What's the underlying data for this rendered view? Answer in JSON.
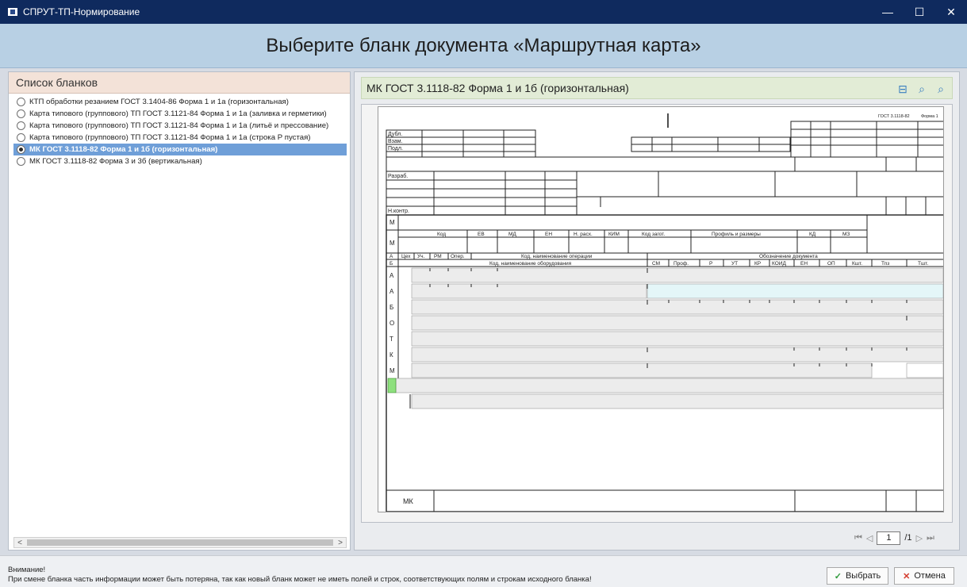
{
  "window": {
    "title": "СПРУТ-ТП-Нормирование",
    "minimize_icon": "—",
    "maximize_icon": "☐",
    "close_icon": "✕"
  },
  "header": {
    "title": "Выберите бланк документа «Маршрутная карта»"
  },
  "blank_list": {
    "heading": "Список бланков",
    "items": [
      {
        "label": "КТП обработки резанием ГОСТ 3.1404-86 Форма 1 и 1а (горизонтальная)",
        "selected": false
      },
      {
        "label": "Карта типового (группового) ТП ГОСТ 3.1121-84 Форма 1 и 1а (заливка и герметики)",
        "selected": false
      },
      {
        "label": "Карта типового (группового) ТП ГОСТ 3.1121-84 Форма 1 и 1а (литьё и прессование)",
        "selected": false
      },
      {
        "label": "Карта типового (группового) ТП ГОСТ 3.1121-84 Форма 1 и 1а (строка Р пустая)",
        "selected": false
      },
      {
        "label": "МК ГОСТ 3.1118-82 Форма 1 и 1б (горизонтальная)",
        "selected": true
      },
      {
        "label": "МК ГОСТ 3.1118-82 Форма 3 и 3б (вертикальная)",
        "selected": false
      }
    ],
    "scroll_left": "<",
    "scroll_right": ">"
  },
  "preview": {
    "title": "МК ГОСТ 3.1118-82 Форма 1 и 1б (горизонтальная)",
    "tools": {
      "fit_icon": "⊟",
      "zoom_out_icon": "⌕",
      "zoom_in_icon": "⌕"
    },
    "form": {
      "gost": "ГОСТ 3.1118-82",
      "forma": "Форма 1",
      "dubl": "Дубл.",
      "vzam": "Взам.",
      "podl": "Подл.",
      "razrab": "Разраб.",
      "nkontr": "Н.контр.",
      "m_headers": [
        "Код",
        "ЕВ",
        "МД",
        "ЕН",
        "Н. расх.",
        "КИМ",
        "Код загот.",
        "Профиль и размеры",
        "КД",
        "МЗ"
      ],
      "a_headers": [
        "А",
        "Цех",
        "Уч.",
        "РМ",
        "Опер.",
        "Код, наименование операции",
        "Обозначение документа"
      ],
      "b_headers": [
        "Б",
        "Код, наименование оборудования",
        "СМ",
        "Проф.",
        "Р",
        "УТ",
        "КР",
        "КОИД",
        "ЕН",
        "ОП",
        "Кшт.",
        "Тпз",
        "Тшт."
      ],
      "row_letters": [
        "А",
        "А",
        "Б",
        "О",
        "Т",
        "К",
        "М"
      ],
      "m_label": "М",
      "footer_code": "МК"
    },
    "pager": {
      "first_icon": "⏮",
      "prev_icon": "◁",
      "page": "1",
      "total": "/1",
      "next_icon": "▷",
      "last_icon": "⏭"
    }
  },
  "footer": {
    "warning_title": "Внимание!",
    "warning_text": "При смене бланка часть информации может быть потеряна, так как новый бланк может не иметь полей и строк, соответствующих полям и строкам исходного бланка!",
    "select_label": "Выбрать",
    "cancel_label": "Отмена",
    "select_icon": "✓",
    "cancel_icon": "✕"
  }
}
